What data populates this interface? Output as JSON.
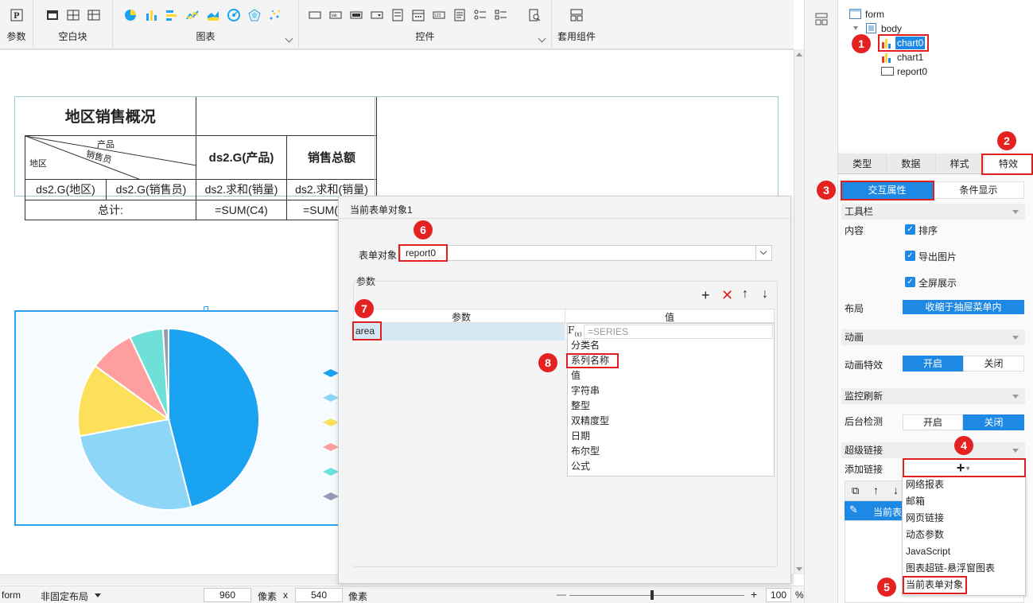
{
  "toolbar": {
    "groups": [
      {
        "label": "参数"
      },
      {
        "label": "空白块"
      },
      {
        "label": "图表"
      },
      {
        "label": "控件"
      },
      {
        "label": "套用组件"
      }
    ]
  },
  "report": {
    "title": "地区销售概况",
    "slant_header": {
      "top": "产品",
      "middle": "销售员",
      "bottom": "地区"
    },
    "col_header_product": "ds2.G(产品)",
    "col_header_total": "销售总额",
    "row_cells": [
      "ds2.G(地区)",
      "ds2.G(销售员)",
      "ds2.求和(销量)",
      "ds2.求和(销量)"
    ],
    "total_row": {
      "label": "总计:",
      "c4": "=SUM(C4)",
      "d4": "=SUM("
    }
  },
  "chart": {
    "slices": [
      {
        "value": 46,
        "color": "#1aa3f0"
      },
      {
        "value": 26,
        "color": "#8ed6f7"
      },
      {
        "value": 13,
        "color": "#fde05a"
      },
      {
        "value": 8,
        "color": "#ff9e9e"
      },
      {
        "value": 6,
        "color": "#6ee0d8"
      },
      {
        "value": 1,
        "color": "#9999b5"
      }
    ]
  },
  "dialog": {
    "title": "当前表单对象1",
    "form_object_label": "表单对象",
    "form_object_value": "report0",
    "params_label": "参数",
    "table_headers": [
      "参数",
      "值"
    ],
    "param_name": "area",
    "formula_placeholder": "=SERIES",
    "value_options": [
      "分类名",
      "系列名称",
      "值",
      "字符串",
      "整型",
      "双精度型",
      "日期",
      "布尔型",
      "公式"
    ]
  },
  "tree": {
    "root": "form",
    "body": "body",
    "children": [
      "chart0",
      "chart1",
      "report0"
    ]
  },
  "tabs": [
    "类型",
    "数据",
    "样式",
    "特效"
  ],
  "subtabs": [
    "交互属性",
    "条件显示"
  ],
  "sections": {
    "toolbar": {
      "title": "工具栏",
      "content_label": "内容",
      "checks": [
        "排序",
        "导出图片",
        "全屏展示"
      ],
      "layout_label": "布局",
      "layout_value": "收缩于抽屉菜单内"
    },
    "animation": {
      "title": "动画",
      "label": "动画特效",
      "on": "开启",
      "off": "关闭"
    },
    "monitor": {
      "title": "监控刷新",
      "label": "后台检测",
      "on": "开启",
      "off": "关闭"
    },
    "hyperlink": {
      "title": "超级链接",
      "add_label": "添加链接",
      "add_symbol": "+",
      "row_label": "当前表",
      "menu": [
        "网络报表",
        "邮箱",
        "网页链接",
        "动态参数",
        "JavaScript",
        "图表超链-悬浮窗图表",
        "当前表单对象"
      ]
    }
  },
  "status": {
    "form": "form",
    "layout": "非固定布局",
    "width": "960",
    "unit1": "像素",
    "x": "x",
    "height": "540",
    "unit2": "像素",
    "zoom": "100",
    "percent": "%",
    "minus": "—",
    "plus": "+"
  },
  "markers": [
    "1",
    "2",
    "3",
    "4",
    "5",
    "6",
    "7",
    "8"
  ],
  "colors": {
    "accent": "#1e90ff",
    "marker": "#e52222"
  }
}
